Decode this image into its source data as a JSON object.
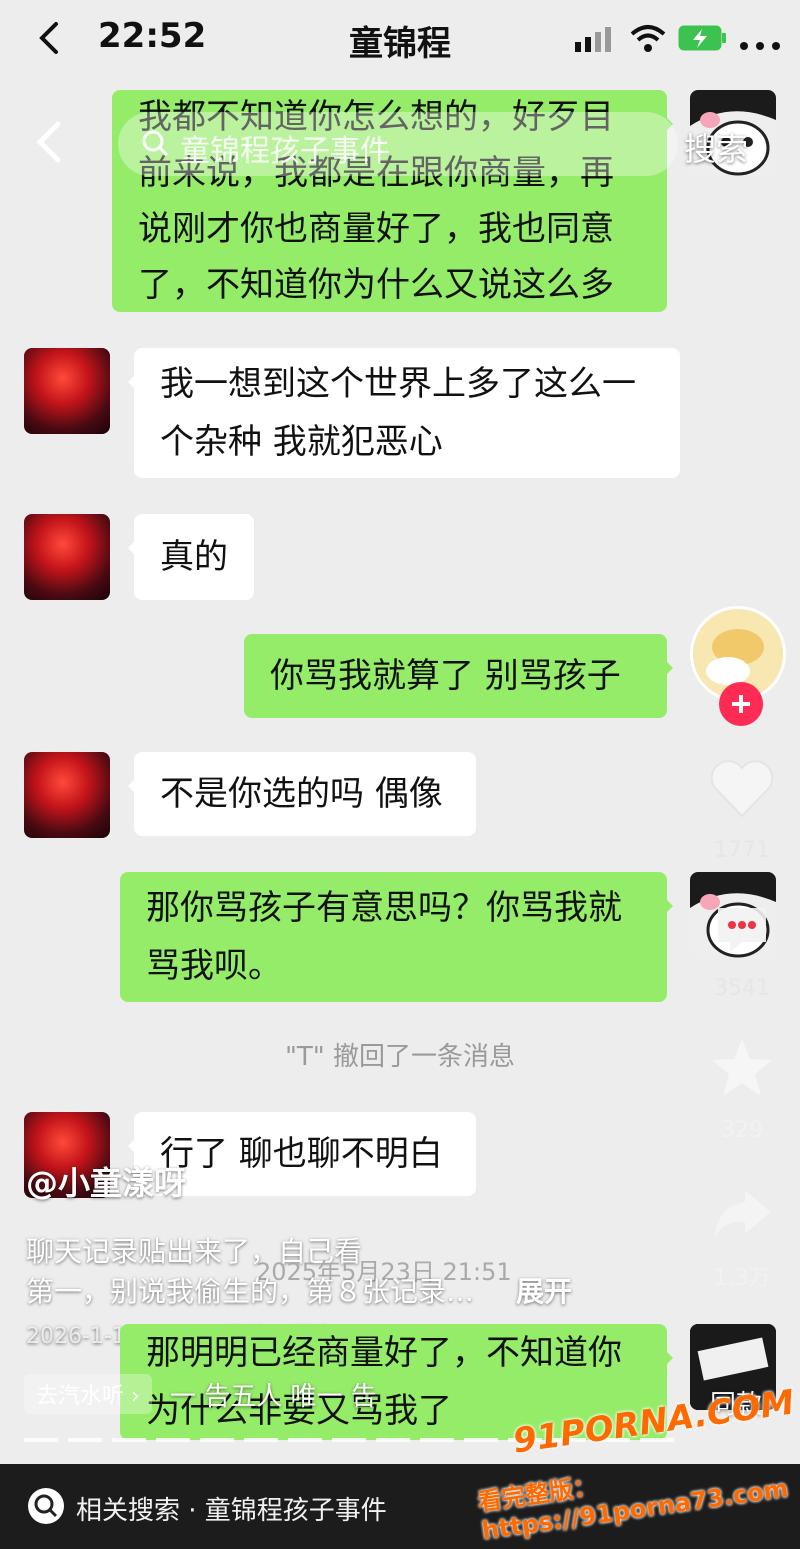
{
  "status_bar": {
    "time": "22:52",
    "title": "童锦程"
  },
  "top_overlay": {
    "search_text": "童锦程孩子事件",
    "search_label": "搜索"
  },
  "messages": {
    "m1": "我都不知道你怎么想的，好歹目前来说，我都是在跟你商量，再说刚才你也商量好了，我也同意了，不知道你为什么又说这么多",
    "m2a": "我一想到这个世界上多了这么一",
    "m2b": "个杂种 我就犯恶心",
    "m3": "真的",
    "m4": "你骂我就算了 别骂孩子",
    "m5": "不是你选的吗 偶像",
    "m6a": "那你骂孩子有意思吗？你骂我就",
    "m6b": "骂我呗。",
    "recall": "\"T\" 撤回了一条消息",
    "m7": "行了 聊也聊不明白",
    "timestamp": "2025年5月23日 21:51",
    "m8a": "那明明已经商量好了，不知道你",
    "m8b": "为什么非要又骂我了"
  },
  "side": {
    "likes": "1771",
    "comments": "3541",
    "favorites": "329",
    "shares": "1.3万",
    "music_label": "同款"
  },
  "post": {
    "author": "@小童漾呀",
    "line1": "聊天记录贴出来了，自己看",
    "line2": "第一，别说我偷生的，第８张记录…",
    "expand": "展开",
    "meta": "2026-1-1 16:10 IP属地：福建",
    "music": "去汽水听 ›",
    "music_song": "一 告五人 唯一 告"
  },
  "bottom_search": {
    "label": "相关搜索 · 童锦程孩子事件"
  },
  "watermark": {
    "brand": "91PORNA.COM",
    "url": "看完整版：https://91porna73.com"
  },
  "colors": {
    "green_bubble": "#95ec69",
    "white_bubble": "#ffffff",
    "background": "#ededed",
    "follow_plus": "#fe2c55"
  }
}
